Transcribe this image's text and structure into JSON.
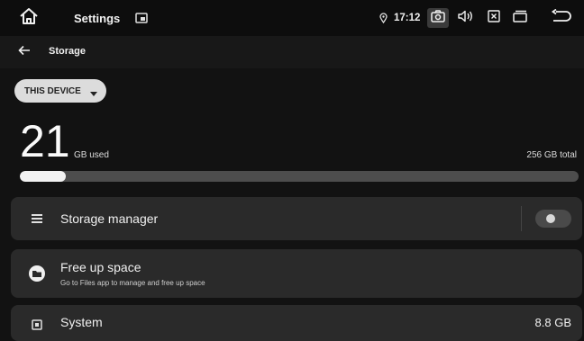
{
  "status_bar": {
    "app_title": "Settings",
    "time": "17:12",
    "icons": [
      "home-icon",
      "app-window-icon",
      "location-icon",
      "camera-icon",
      "volume-icon",
      "close-box-icon",
      "recents-icon",
      "back-icon"
    ]
  },
  "toolbar": {
    "title": "Storage",
    "back_icon": "arrow-left-icon"
  },
  "device_selector": {
    "label": "THIS DEVICE",
    "icon": "chevron-down-icon"
  },
  "storage_summary": {
    "used_value": "21",
    "used_unit": "GB used",
    "total_label": "256 GB total",
    "used_fraction": 0.082
  },
  "items": [
    {
      "label": "Storage manager",
      "icon": "list-icon",
      "toggle_on": false
    },
    {
      "label": "Free up space",
      "subtitle": "Go to Files app to manage and free up space",
      "icon": "files-icon"
    },
    {
      "label": "System",
      "value": "8.8 GB",
      "icon": "system-icon"
    }
  ],
  "colors": {
    "background": "#121212",
    "card": "#2a2a2a",
    "bar_fill": "#f2f2f2",
    "bar_track": "#4d4d4d",
    "chip": "#dcdcdc"
  }
}
